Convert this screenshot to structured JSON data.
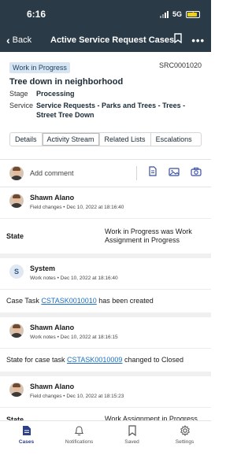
{
  "status_bar": {
    "time": "6:16",
    "network": "5G"
  },
  "nav": {
    "back_label": "Back",
    "title": "Active Service Request Cases"
  },
  "record": {
    "state_badge": "Work in Progress",
    "number": "SRC0001020",
    "title": "Tree down in neighborhood",
    "stage_label": "Stage",
    "stage_value": "Processing",
    "service_label": "Service",
    "service_value": "Service Requests - Parks and Trees - Trees - Street Tree Down"
  },
  "tabs": [
    "Details",
    "Activity Stream",
    "Related Lists",
    "Escalations"
  ],
  "active_tab": "Activity Stream",
  "comment": {
    "placeholder": "Add comment"
  },
  "entries": [
    {
      "author": "Shawn Alano",
      "kind": "Field changes",
      "date": "Dec 10, 2022 at 18:16:40",
      "field": "State",
      "value": "Work in Progress was Work Assignment in Progress"
    },
    {
      "author": "System",
      "avatar_letter": "S",
      "kind": "Work notes",
      "date": "Dec 10, 2022 at 18:16:40",
      "text_before": "Case Task ",
      "link": "CSTASK0010010",
      "text_after": " has been created"
    },
    {
      "author": "Shawn Alano",
      "kind": "Work notes",
      "date": "Dec 10, 2022 at 18:16:15",
      "text_before": "State for case task ",
      "link": "CSTASK0010009",
      "text_after": " changed to Closed"
    },
    {
      "author": "Shawn Alano",
      "kind": "Field changes",
      "date": "Dec 10, 2022 at 18:15:23",
      "field": "State",
      "value": "Work Assignment in Progress"
    }
  ],
  "tabbar": {
    "items": [
      {
        "label": "Cases",
        "icon": "document-icon",
        "active": true
      },
      {
        "label": "Notifications",
        "icon": "bell-icon",
        "active": false
      },
      {
        "label": "Saved",
        "icon": "bookmark-icon",
        "active": false
      },
      {
        "label": "Settings",
        "icon": "gear-icon",
        "active": false
      }
    ]
  },
  "colors": {
    "topbar": "#2a3a47",
    "accent": "#2b3f8c",
    "link": "#1a6fc4",
    "badge_bg": "#d7e5f2"
  }
}
